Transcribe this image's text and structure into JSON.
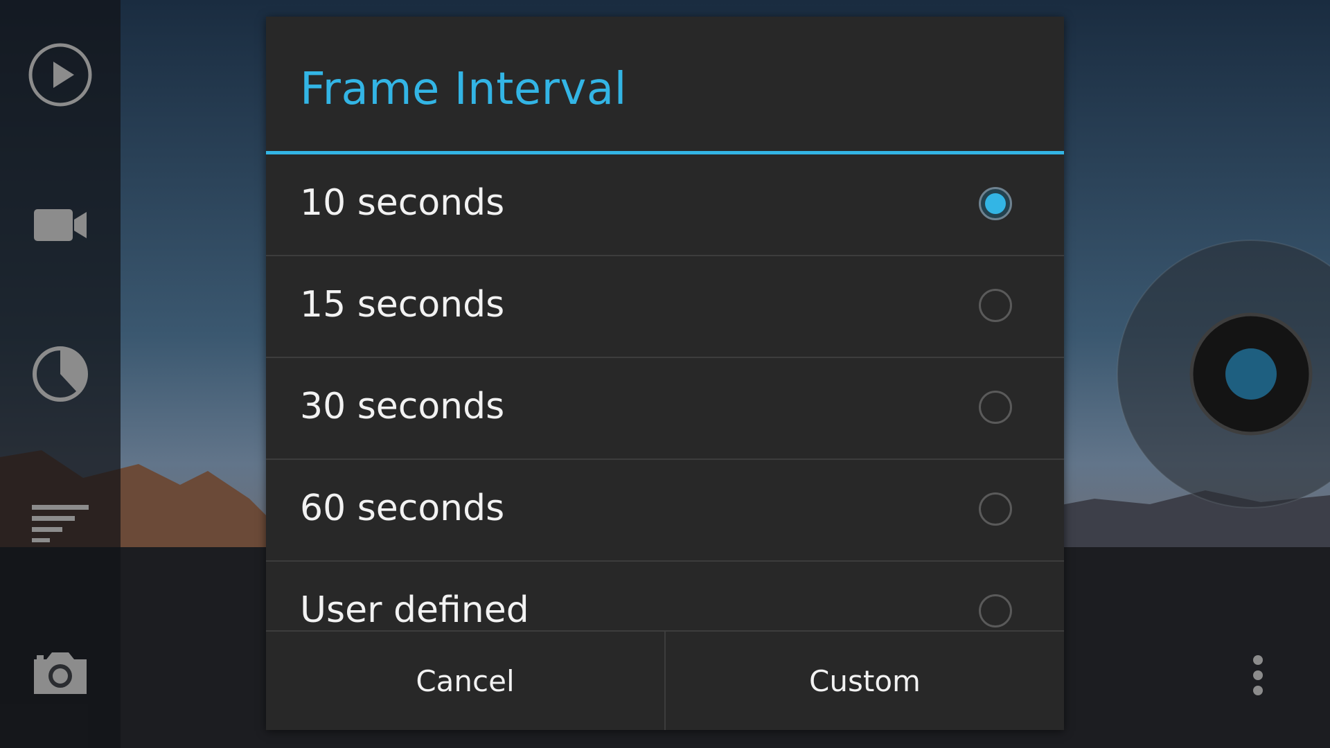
{
  "dialog": {
    "title": "Frame Interval",
    "options": [
      {
        "label": "10 seconds",
        "selected": true
      },
      {
        "label": "15 seconds",
        "selected": false
      },
      {
        "label": "30 seconds",
        "selected": false
      },
      {
        "label": "60 seconds",
        "selected": false
      },
      {
        "label": "User defined",
        "selected": false
      }
    ],
    "buttons": {
      "cancel": "Cancel",
      "custom": "Custom"
    }
  },
  "sidebar": {
    "icons": [
      "play-icon",
      "video-camera-icon",
      "timer-icon",
      "sort-list-icon",
      "camera-icon"
    ]
  },
  "colors": {
    "accent": "#33b5e5",
    "dialog_bg": "#282828",
    "divider": "#3d3d3d"
  }
}
